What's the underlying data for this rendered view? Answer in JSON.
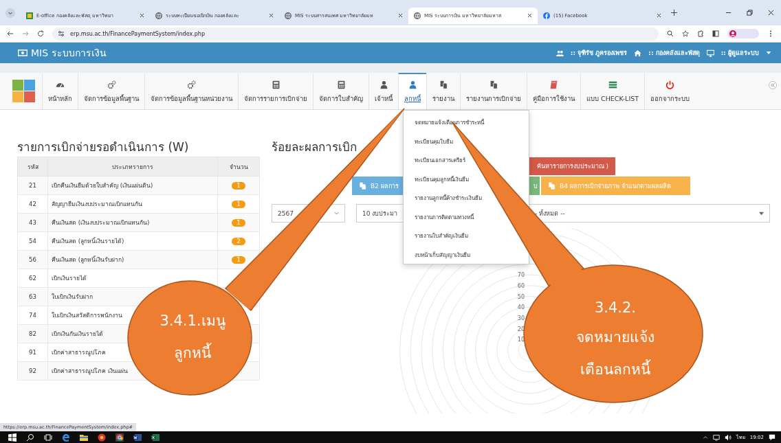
{
  "browser": {
    "tabs": [
      {
        "title": "E-office กองคลังและพัสดุ มหาวิทยา",
        "kind": "office",
        "selected": false
      },
      {
        "title": "ระบบทะเบียนขอเบิกเงิน กองคลังและ",
        "kind": "globe",
        "selected": false
      },
      {
        "title": "MIS ระบบสารสนเทศ มหาวิทยาลัยมห",
        "kind": "globe",
        "selected": false
      },
      {
        "title": "MIS ระบบการเงิน มหาวิทยาลัยมหาส",
        "kind": "globe",
        "selected": true
      },
      {
        "title": "(15) Facebook",
        "kind": "facebook",
        "selected": false
      }
    ],
    "url": "erp.msu.ac.th/FinancePaymentSystem/index.php"
  },
  "header": {
    "title": "MIS ระบบการเงิน",
    "user": ":: จุฑิรัช ภูครองเพชร",
    "department": ":: กองคลังและพัสดุ",
    "role": ":: ผู้ดูแลระบบ"
  },
  "toolbar": {
    "items": [
      {
        "label": "หน้าหลัก",
        "kind": "dashboard",
        "selected": false
      },
      {
        "label": "จัดการข้อมูลพื้นฐาน",
        "kind": "cogs",
        "selected": false
      },
      {
        "label": "จัดการข้อมูลพื้นฐานหน่วยงาน",
        "kind": "cogs",
        "selected": false
      },
      {
        "label": "จัดการรายการเบิกจ่าย",
        "kind": "calculator",
        "selected": false
      },
      {
        "label": "จัดการใบสำคัญ",
        "kind": "calculator",
        "selected": false
      },
      {
        "label": "เจ้าหนี้",
        "kind": "user",
        "selected": false
      },
      {
        "label": "ลูกหนี้",
        "kind": "user",
        "selected": true
      },
      {
        "label": "รายงาน",
        "kind": "copy",
        "selected": false
      },
      {
        "label": "รายงานการเบิกจ่าย",
        "kind": "copy",
        "selected": false
      },
      {
        "label": "คู่มือการใช้งาน",
        "kind": "book",
        "selected": false
      },
      {
        "label": "แบบ CHECK-LIST",
        "kind": "checklist",
        "selected": false
      },
      {
        "label": "ออกจากระบบ",
        "kind": "power",
        "selected": false
      }
    ]
  },
  "dropdown": {
    "items": [
      "จดหมายแจ้งเตือนการชำระหนี้",
      "ทะเบียนคุมใบยืม",
      "ทะเบียนเอกสารเครียร์",
      "ทะเบียนคุมลูกหนี้เงินยืม",
      "รายงานลูกหนี้ค้างชำระเงินยืม",
      "รายงานการติดตามทวงหนี้",
      "รายงานใบสำคัญเงินยืม",
      "งบหน้าเก็บสัญญาเงินยืม"
    ]
  },
  "pending": {
    "title": "รายการเบิกจ่ายรอดำเนินการ (W)",
    "columns": [
      "รหัส",
      "ประเภทรายการ",
      "จำนวน"
    ],
    "rows": [
      {
        "code": "21",
        "name": "เบิกคืนเงินยืมด้วยใบสำคัญ (เงินแผ่นดิน)",
        "count": "1"
      },
      {
        "code": "42",
        "name": "สัญญายืมเงินงบประมาณเบิกแทนกัน",
        "count": "1"
      },
      {
        "code": "43",
        "name": "คืนเงินสด (เงินงบประมาณเบิกแทนกัน)",
        "count": "1"
      },
      {
        "code": "54",
        "name": "คืนเงินสด (ลูกหนี้เงินรายได้)",
        "count": "2"
      },
      {
        "code": "56",
        "name": "คืนเงินสด (ลูกหนี้เงินรับฝาก)",
        "count": "1"
      },
      {
        "code": "62",
        "name": "เบิกเงินรายได้"
      },
      {
        "code": "63",
        "name": "ใบเบิกเงินรับฝาก"
      },
      {
        "code": "74",
        "name": "ใบเบิกเงินสวัสดิการพนักงาน"
      },
      {
        "code": "82",
        "name": "เบิกเงินกันเงินรายได้"
      },
      {
        "code": "91",
        "name": "เบิกค่าสาธารณูปโภค"
      },
      {
        "code": "92",
        "name": "เบิกค่าสาธารณูปโภค เงินแผ่น"
      }
    ]
  },
  "results": {
    "title": "ร้อยละผลการเบิก",
    "buttons": [
      {
        "label": "ค้นหารายการงบประมาณ )",
        "kind": "danger"
      },
      {
        "label": "B2 ผลการ",
        "kind": "info"
      },
      {
        "label": "บ",
        "kind": "success"
      },
      {
        "label": "B4 ผลการเบิกจ่ายภาพ จำแนกตามผลผลิต",
        "kind": "warning"
      }
    ],
    "selects": [
      {
        "value": "2567"
      },
      {
        "value": "10 งบประมา"
      },
      {
        "value": "-- ทั้งหมด --"
      }
    ],
    "scale_labels": [
      "70",
      "60",
      "50",
      "40",
      "30",
      "20",
      "10"
    ]
  },
  "callouts": [
    {
      "lines": [
        "3.4.1.เมนู",
        "ลูกหนี้"
      ]
    },
    {
      "lines": [
        "3.4.2.",
        "จดหมายแจ้ง",
        "เตือนลกหนี้"
      ]
    }
  ],
  "status_url": "https://erp.msu.ac.th/FinancePaymentSystem/index.php#",
  "taskbar": {
    "language": "ไทย",
    "time": "19:02"
  }
}
